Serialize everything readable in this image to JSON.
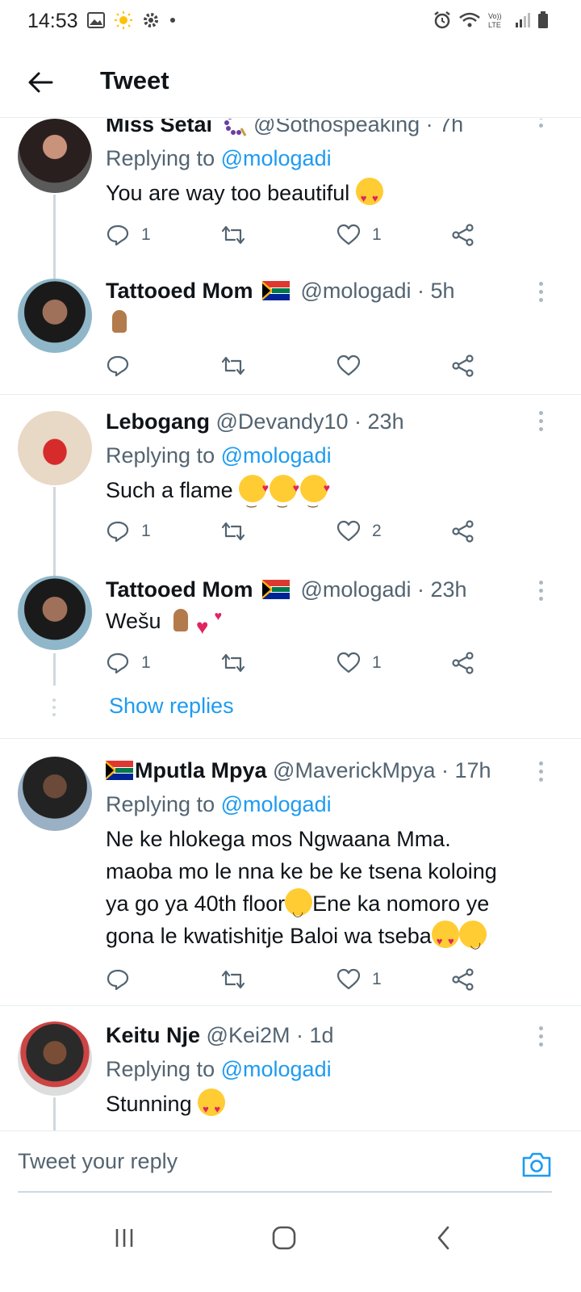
{
  "status_bar": {
    "time": "14:53"
  },
  "header": {
    "title": "Tweet"
  },
  "tweets": [
    {
      "name": "Miss Setai",
      "handle": "@Sothospeaking",
      "time": "· 7h",
      "replying_label": "Replying to",
      "replying_to": "@mologadi",
      "text": "You are way too beautiful",
      "replies": "1",
      "likes": "1"
    },
    {
      "name": "Tattooed Mom",
      "handle": "@mologadi",
      "time": "· 5h",
      "text": "",
      "replies": "",
      "likes": ""
    },
    {
      "name": "Lebogang",
      "handle": "@Devandy10",
      "time": "· 23h",
      "replying_label": "Replying to",
      "replying_to": "@mologadi",
      "text": "Such a flame",
      "replies": "1",
      "likes": "2"
    },
    {
      "name": "Tattooed Mom",
      "handle": "@mologadi",
      "time": "· 23h",
      "text": "Wešu",
      "replies": "1",
      "likes": "1"
    },
    {
      "name": "Mputla Mpya",
      "handle": "@MaverickMpya",
      "time": "· 17h",
      "replying_label": "Replying to",
      "replying_to": "@mologadi",
      "text_lines": [
        "Ne ke hlokega mos Ngwaana Mma.",
        "maoba mo le nna ke be ke tsena koloing",
        "ya go ya 40th floor",
        "Ene ka nomoro ye",
        "gona le kwatishitje Baloi wa tseba"
      ],
      "replies": "",
      "likes": "1"
    },
    {
      "name": "Keitu Nje",
      "handle": "@Kei2M",
      "time": "· 1d",
      "replying_label": "Replying to",
      "replying_to": "@mologadi",
      "text": "Stunning"
    }
  ],
  "show_replies": "Show replies",
  "composer": {
    "placeholder": "Tweet your reply"
  },
  "colors": {
    "link": "#1d9bf0",
    "muted": "#536471",
    "divider": "#e6ecf0"
  }
}
